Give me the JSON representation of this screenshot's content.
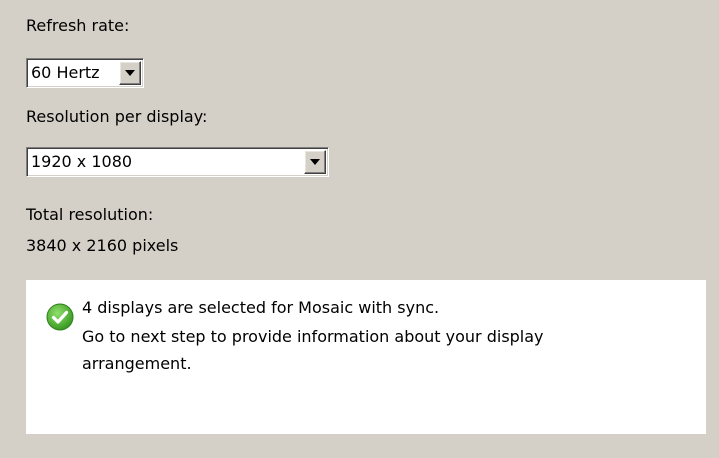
{
  "refresh": {
    "label": "Refresh rate:",
    "selected": "60 Hertz"
  },
  "resolution": {
    "label": "Resolution per display:",
    "selected": "1920 x 1080"
  },
  "total": {
    "label": "Total resolution:",
    "value": "3840 x 2160 pixels"
  },
  "info": {
    "icon": "check-circle-icon",
    "icon_color": "#4caf32",
    "line1": "4 displays are selected for Mosaic with sync.",
    "line2": "Go to next step to provide information about your display",
    "line3": "arrangement."
  }
}
